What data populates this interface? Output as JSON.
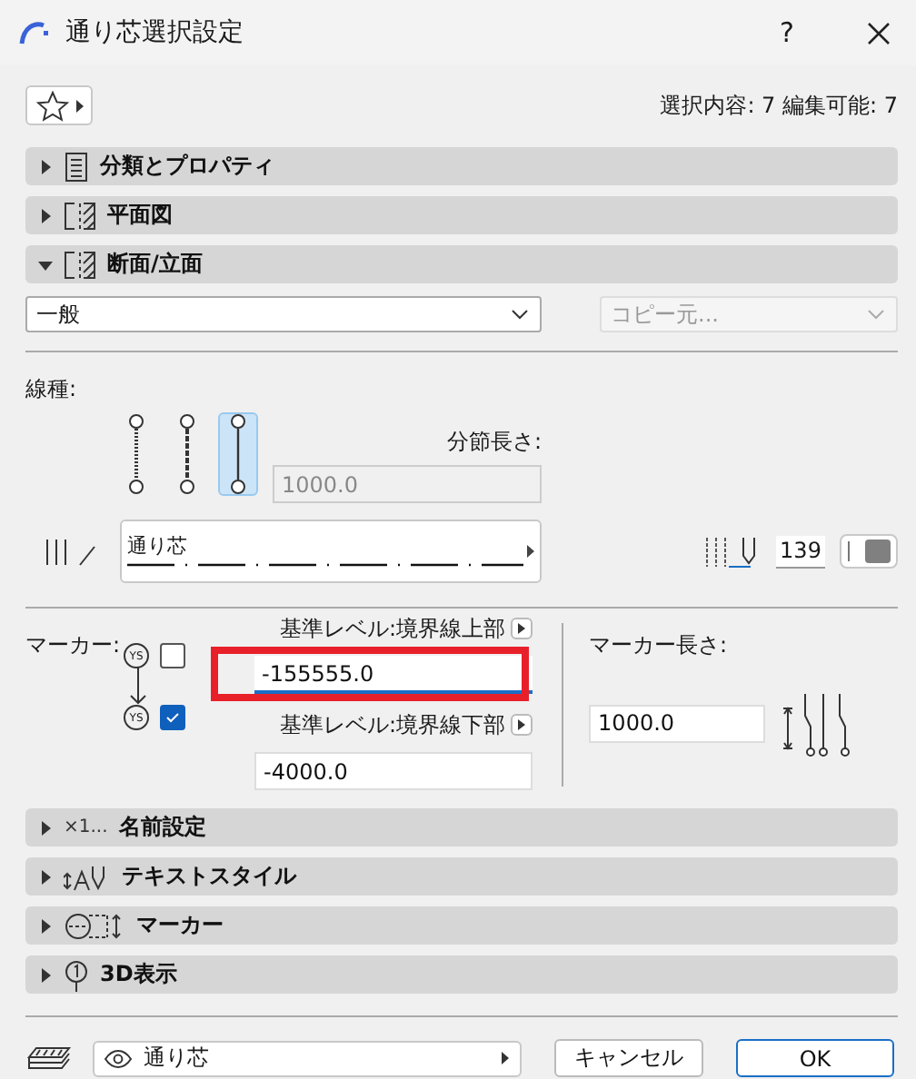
{
  "window": {
    "title": "通り芯選択設定",
    "help": "?"
  },
  "selection_info": "選択内容: 7 編集可能: 7",
  "panels_top": [
    {
      "title": "分類とプロパティ",
      "kind": "properties",
      "expanded": false
    },
    {
      "title": "平面図",
      "kind": "plan",
      "expanded": false
    },
    {
      "title": "断面/立面",
      "kind": "plan",
      "expanded": true
    }
  ],
  "section_view": {
    "preset": "一般",
    "copy_from": "コピー元...",
    "copy_disabled": true
  },
  "line_type": {
    "label": "線種:",
    "styles": [
      {
        "kind": "dotted",
        "selected": false
      },
      {
        "kind": "dashed",
        "selected": false
      },
      {
        "kind": "solid",
        "selected": true
      }
    ],
    "segment_label": "分節長さ:",
    "segment_value": "1000.0",
    "segment_disabled": true,
    "line_name": "通り芯",
    "pen": "139"
  },
  "marker": {
    "label": "マーカー:",
    "ends": [
      {
        "symbol": "YS",
        "checked": false
      },
      {
        "symbol": "YS",
        "checked": true
      }
    ],
    "levels": [
      {
        "label": "基準レベル:境界線上部",
        "value": "-155555.0",
        "focused": true,
        "highlighted": true
      },
      {
        "label": "基準レベル:境界線下部",
        "value": "-4000.0",
        "focused": false,
        "highlighted": false
      }
    ],
    "length_label": "マーカー長さ:",
    "length_value": "1000.0"
  },
  "panels_bottom": [
    {
      "title": "名前設定",
      "kind": "name",
      "icon_text": "×1...",
      "expanded": false
    },
    {
      "title": "テキストスタイル",
      "kind": "text",
      "expanded": false
    },
    {
      "title": "マーカー",
      "kind": "marker",
      "expanded": false
    },
    {
      "title": "3D表示",
      "kind": "view3d",
      "expanded": false
    }
  ],
  "footer": {
    "layer": "通り芯",
    "cancel": "キャンセル",
    "ok": "OK"
  }
}
